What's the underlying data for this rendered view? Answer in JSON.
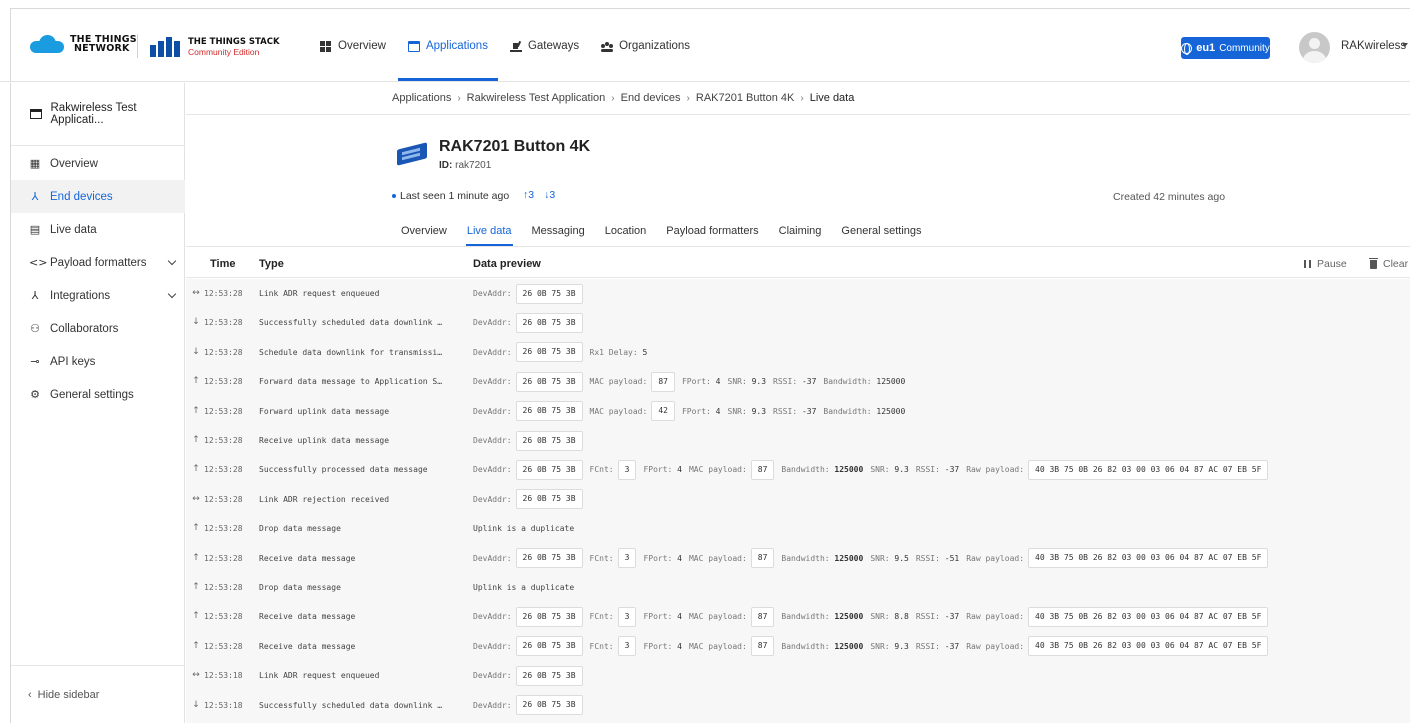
{
  "brand": {
    "ttn_line1": "THE THINGS",
    "ttn_line2": "NETWORK",
    "stack_line1": "THE THINGS STACK",
    "stack_line2": "Community Edition"
  },
  "nav": {
    "overview": "Overview",
    "applications": "Applications",
    "gateways": "Gateways",
    "organizations": "Organizations"
  },
  "region": {
    "code": "eu1",
    "label": "Community"
  },
  "user": {
    "name": "RAKwireless"
  },
  "sidebar": {
    "app_name": "Rakwireless Test Applicati...",
    "items": [
      {
        "label": "Overview",
        "icon": "▦"
      },
      {
        "label": "End devices",
        "icon": "⅄"
      },
      {
        "label": "Live data",
        "icon": "▤"
      },
      {
        "label": "Payload formatters",
        "icon": "<>"
      },
      {
        "label": "Integrations",
        "icon": "⅄"
      },
      {
        "label": "Collaborators",
        "icon": "⚇"
      },
      {
        "label": "API keys",
        "icon": "⊸"
      },
      {
        "label": "General settings",
        "icon": "⚙"
      }
    ],
    "hide_label": "Hide sidebar"
  },
  "breadcrumb": [
    "Applications",
    "Rakwireless Test Application",
    "End devices",
    "RAK7201 Button 4K",
    "Live data"
  ],
  "device": {
    "name": "RAK7201 Button 4K",
    "id_label": "ID:",
    "id": "rak7201",
    "last_seen": "Last seen 1 minute ago",
    "up_count": "↑3",
    "down_count": "↓3",
    "created": "Created 42 minutes ago"
  },
  "tabs": [
    "Overview",
    "Live data",
    "Messaging",
    "Location",
    "Payload formatters",
    "Claiming",
    "General settings"
  ],
  "table": {
    "col_time": "Time",
    "col_type": "Type",
    "col_data": "Data preview",
    "pause": "Pause",
    "clear": "Clear"
  },
  "events": [
    {
      "dir": "↔",
      "time": "12:53:28",
      "type": "Link ADR request enqueued",
      "data": [
        [
          "DevAddr:",
          "26 0B 75 3B"
        ]
      ]
    },
    {
      "dir": "↓",
      "time": "12:53:28",
      "type": "Successfully scheduled data downlink …",
      "data": [
        [
          "DevAddr:",
          "26 0B 75 3B"
        ]
      ]
    },
    {
      "dir": "↓",
      "time": "12:53:28",
      "type": "Schedule data downlink for transmissi…",
      "data": [
        [
          "DevAddr:",
          "26 0B 75 3B"
        ],
        [
          "Rx1 Delay:",
          "5",
          "kv"
        ]
      ]
    },
    {
      "dir": "↑",
      "time": "12:53:28",
      "type": "Forward data message to Application S…",
      "data": [
        [
          "DevAddr:",
          "26 0B 75 3B"
        ],
        [
          "MAC payload:",
          "87"
        ],
        [
          "FPort:",
          "4",
          "kv"
        ],
        [
          "SNR:",
          "9.3",
          "kv"
        ],
        [
          "RSSI:",
          "-37",
          "kv"
        ],
        [
          "Bandwidth:",
          "125000",
          "kv"
        ]
      ]
    },
    {
      "dir": "↑",
      "time": "12:53:28",
      "type": "Forward uplink data message",
      "data": [
        [
          "DevAddr:",
          "26 0B 75 3B"
        ],
        [
          "MAC payload:",
          "42"
        ],
        [
          "FPort:",
          "4",
          "kv"
        ],
        [
          "SNR:",
          "9.3",
          "kv"
        ],
        [
          "RSSI:",
          "-37",
          "kv"
        ],
        [
          "Bandwidth:",
          "125000",
          "kv"
        ]
      ]
    },
    {
      "dir": "↑",
      "time": "12:53:28",
      "type": "Receive uplink data message",
      "data": [
        [
          "DevAddr:",
          "26 0B 75 3B"
        ]
      ]
    },
    {
      "dir": "↑",
      "time": "12:53:28",
      "type": "Successfully processed data message",
      "data": [
        [
          "DevAddr:",
          "26 0B 75 3B"
        ],
        [
          "FCnt:",
          "3"
        ],
        [
          "FPort:",
          "4",
          "kv"
        ],
        [
          "MAC payload:",
          "87"
        ],
        [
          "Bandwidth:",
          "125000",
          "kvb"
        ],
        [
          "SNR:",
          "9.3",
          "kv"
        ],
        [
          "RSSI:",
          "-37",
          "kv"
        ],
        [
          "Raw payload:",
          "40 3B 75 0B 26 82 03 00 03 06 04 87 AC 07 EB 5F"
        ]
      ]
    },
    {
      "dir": "↔",
      "time": "12:53:28",
      "type": "Link ADR rejection received",
      "data": [
        [
          "DevAddr:",
          "26 0B 75 3B"
        ]
      ]
    },
    {
      "dir": "↑",
      "time": "12:53:28",
      "type": "Drop data message",
      "data": [
        [
          "",
          "Uplink is a duplicate",
          "plain"
        ]
      ]
    },
    {
      "dir": "↑",
      "time": "12:53:28",
      "type": "Receive data message",
      "data": [
        [
          "DevAddr:",
          "26 0B 75 3B"
        ],
        [
          "FCnt:",
          "3"
        ],
        [
          "FPort:",
          "4",
          "kv"
        ],
        [
          "MAC payload:",
          "87"
        ],
        [
          "Bandwidth:",
          "125000",
          "kvb"
        ],
        [
          "SNR:",
          "9.5",
          "kv"
        ],
        [
          "RSSI:",
          "-51",
          "kv"
        ],
        [
          "Raw payload:",
          "40 3B 75 0B 26 82 03 00 03 06 04 87 AC 07 EB 5F"
        ]
      ]
    },
    {
      "dir": "↑",
      "time": "12:53:28",
      "type": "Drop data message",
      "data": [
        [
          "",
          "Uplink is a duplicate",
          "plain"
        ]
      ]
    },
    {
      "dir": "↑",
      "time": "12:53:28",
      "type": "Receive data message",
      "data": [
        [
          "DevAddr:",
          "26 0B 75 3B"
        ],
        [
          "FCnt:",
          "3"
        ],
        [
          "FPort:",
          "4",
          "kv"
        ],
        [
          "MAC payload:",
          "87"
        ],
        [
          "Bandwidth:",
          "125000",
          "kvb"
        ],
        [
          "SNR:",
          "8.8",
          "kv"
        ],
        [
          "RSSI:",
          "-37",
          "kv"
        ],
        [
          "Raw payload:",
          "40 3B 75 0B 26 82 03 00 03 06 04 87 AC 07 EB 5F"
        ]
      ]
    },
    {
      "dir": "↑",
      "time": "12:53:28",
      "type": "Receive data message",
      "data": [
        [
          "DevAddr:",
          "26 0B 75 3B"
        ],
        [
          "FCnt:",
          "3"
        ],
        [
          "FPort:",
          "4",
          "kv"
        ],
        [
          "MAC payload:",
          "87"
        ],
        [
          "Bandwidth:",
          "125000",
          "kvb"
        ],
        [
          "SNR:",
          "9.3",
          "kv"
        ],
        [
          "RSSI:",
          "-37",
          "kv"
        ],
        [
          "Raw payload:",
          "40 3B 75 0B 26 82 03 00 03 06 04 87 AC 07 EB 5F"
        ]
      ]
    },
    {
      "dir": "↔",
      "time": "12:53:18",
      "type": "Link ADR request enqueued",
      "data": [
        [
          "DevAddr:",
          "26 0B 75 3B"
        ]
      ]
    },
    {
      "dir": "↓",
      "time": "12:53:18",
      "type": "Successfully scheduled data downlink …",
      "data": [
        [
          "DevAddr:",
          "26 0B 75 3B"
        ]
      ]
    }
  ],
  "colors": {
    "accent": "#1565d8",
    "background_events": "#f7f7f7"
  }
}
